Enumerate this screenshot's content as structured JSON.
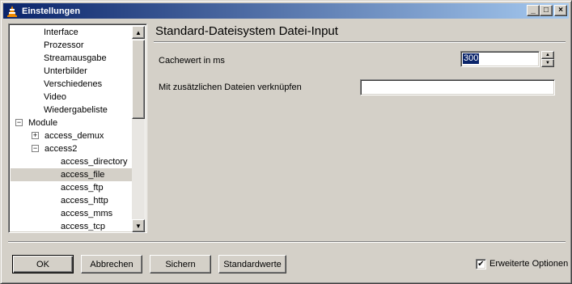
{
  "window": {
    "title": "Einstellungen",
    "buttons": {
      "minimize": "_",
      "maximize": "□",
      "close": "×"
    }
  },
  "tree": {
    "items": [
      {
        "label": "Interface",
        "level": 2,
        "expander": ""
      },
      {
        "label": "Prozessor",
        "level": 2,
        "expander": ""
      },
      {
        "label": "Streamausgabe",
        "level": 2,
        "expander": ""
      },
      {
        "label": "Unterbilder",
        "level": 2,
        "expander": ""
      },
      {
        "label": "Verschiedenes",
        "level": 2,
        "expander": ""
      },
      {
        "label": "Video",
        "level": 2,
        "expander": ""
      },
      {
        "label": "Wiedergabeliste",
        "level": 2,
        "expander": ""
      },
      {
        "label": "Module",
        "level": 0,
        "expander": "−"
      },
      {
        "label": "access_demux",
        "level": 1,
        "expander": "+"
      },
      {
        "label": "access2",
        "level": 1,
        "expander": "−"
      },
      {
        "label": "access_directory",
        "level": 3,
        "expander": ""
      },
      {
        "label": "access_file",
        "level": 3,
        "expander": "",
        "selected": true
      },
      {
        "label": "access_ftp",
        "level": 3,
        "expander": ""
      },
      {
        "label": "access_http",
        "level": 3,
        "expander": ""
      },
      {
        "label": "access_mms",
        "level": 3,
        "expander": ""
      },
      {
        "label": "access_tcp",
        "level": 3,
        "expander": ""
      }
    ],
    "scroll_up_icon": "▲",
    "scroll_down_icon": "▼"
  },
  "panel": {
    "title": "Standard-Dateisystem Datei-Input",
    "cache_label": "Cachewert in ms",
    "cache_value": "300",
    "link_label": "Mit zusätzlichen Dateien verknüpfen",
    "link_value": "",
    "spin_up": "▲",
    "spin_down": "▼"
  },
  "buttons": {
    "ok": "OK",
    "cancel": "Abbrechen",
    "save": "Sichern",
    "defaults": "Standardwerte"
  },
  "advanced": {
    "label": "Erweiterte Optionen",
    "checked": true,
    "check_mark": "✔"
  },
  "colors": {
    "title_bar_start": "#0a246a",
    "title_bar_end": "#a6caf0",
    "face": "#d4d0c8",
    "selection": "#0a246a"
  }
}
